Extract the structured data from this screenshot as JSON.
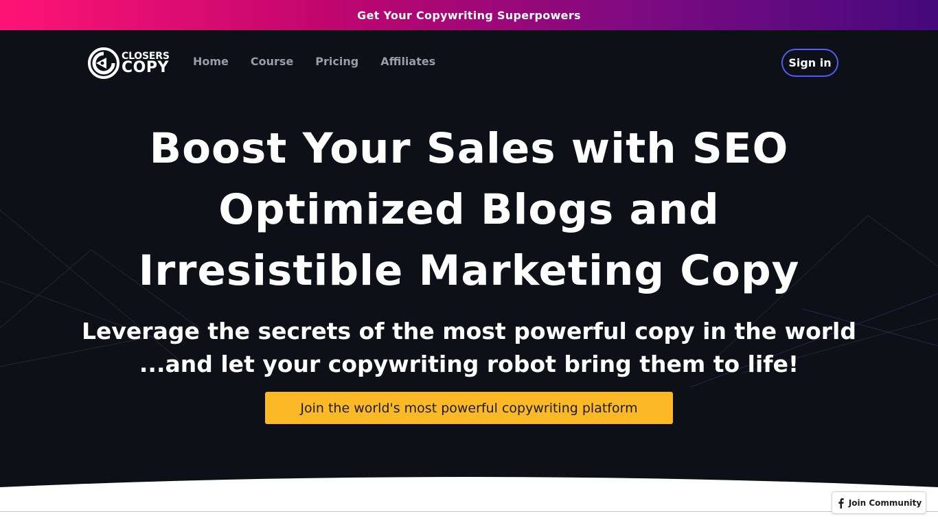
{
  "promo": {
    "text": "Get Your Copywriting Superpowers"
  },
  "header": {
    "logo": {
      "line1": "CLOSERS",
      "line2": "COPY"
    },
    "nav": [
      {
        "label": "Home"
      },
      {
        "label": "Course"
      },
      {
        "label": "Pricing"
      },
      {
        "label": "Affiliates"
      }
    ],
    "signin_label": "Sign in"
  },
  "hero": {
    "title": "Boost Your Sales with SEO Optimized Blogs and Irresistible Marketing Copy",
    "subtitle_line1": "Leverage the secrets of the most powerful copy in the world",
    "subtitle_line2": "...and let your copywriting robot bring them to life!",
    "cta_label": "Join the world's most powerful copywriting platform"
  },
  "community_widget": {
    "label": "Join Community",
    "icon": "facebook-icon"
  },
  "colors": {
    "promo_gradient_start": "#ff1475",
    "promo_gradient_end": "#45097c",
    "background": "#0e1018",
    "cta": "#fbb927",
    "signin_border": "#4f5dff"
  }
}
